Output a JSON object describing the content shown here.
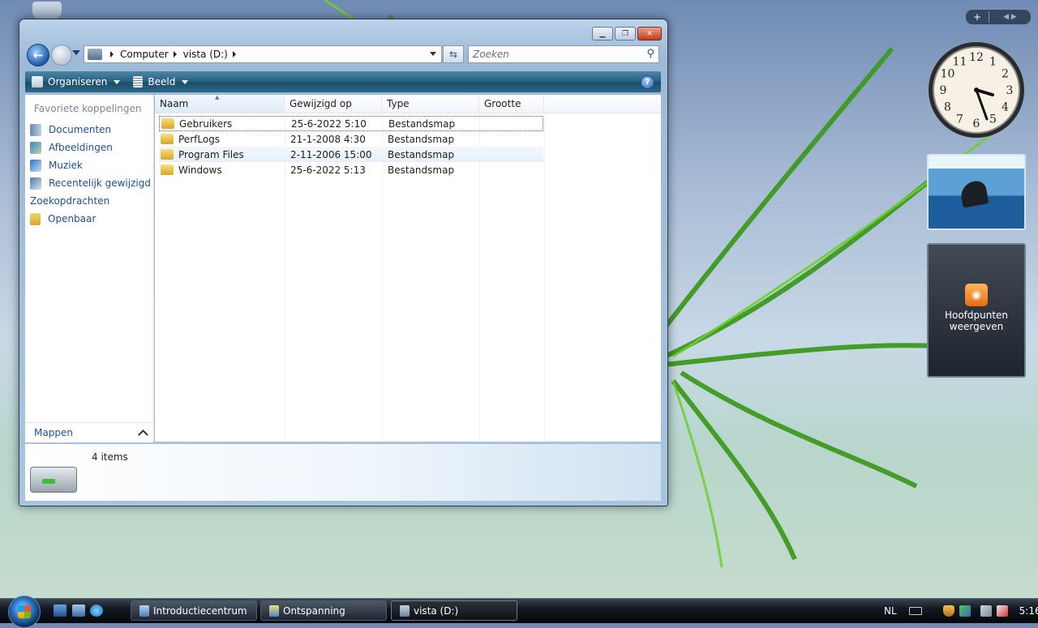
{
  "window": {
    "address": {
      "crumbs": [
        "Computer",
        "vista (D:)"
      ]
    },
    "search": {
      "placeholder": "Zoeken"
    },
    "toolbar": {
      "organize": "Organiseren",
      "view": "Beeld",
      "help": "?"
    },
    "nav": {
      "heading": "Favoriete koppelingen",
      "items": [
        {
          "label": "Documenten",
          "icon": "documents-icon"
        },
        {
          "label": "Afbeeldingen",
          "icon": "pictures-icon"
        },
        {
          "label": "Muziek",
          "icon": "music-icon"
        },
        {
          "label": "Recentelijk gewijzigd",
          "icon": "recent-icon"
        },
        {
          "label": "Zoekopdrachten",
          "icon": "searches-icon"
        },
        {
          "label": "Openbaar",
          "icon": "folder-icon"
        }
      ],
      "folders": "Mappen"
    },
    "columns": [
      "Naam",
      "Gewijzigd op",
      "Type",
      "Grootte"
    ],
    "files": [
      {
        "name": "Gebruikers",
        "modified": "25-6-2022 5:10",
        "type": "Bestandsmap",
        "size": ""
      },
      {
        "name": "PerfLogs",
        "modified": "21-1-2008 4:30",
        "type": "Bestandsmap",
        "size": ""
      },
      {
        "name": "Program Files",
        "modified": "2-11-2006 15:00",
        "type": "Bestandsmap",
        "size": ""
      },
      {
        "name": "Windows",
        "modified": "25-6-2022 5:13",
        "type": "Bestandsmap",
        "size": ""
      }
    ],
    "status": {
      "count": "4 items"
    }
  },
  "sidebar": {
    "clock": {
      "numbers": [
        "12",
        "1",
        "2",
        "3",
        "4",
        "5",
        "6",
        "7",
        "8",
        "9",
        "10",
        "11"
      ]
    },
    "feeds": {
      "label_line1": "Hoofdpunten",
      "label_line2": "weergeven"
    }
  },
  "taskbar": {
    "buttons": [
      "Introductiecentrum",
      "Ontspanning",
      "vista (D:)"
    ],
    "language": "NL",
    "time": "5:16"
  },
  "colors": {
    "link": "#1b4f9a",
    "toolbar": "#2a6283",
    "folder": "#e8c04f"
  }
}
